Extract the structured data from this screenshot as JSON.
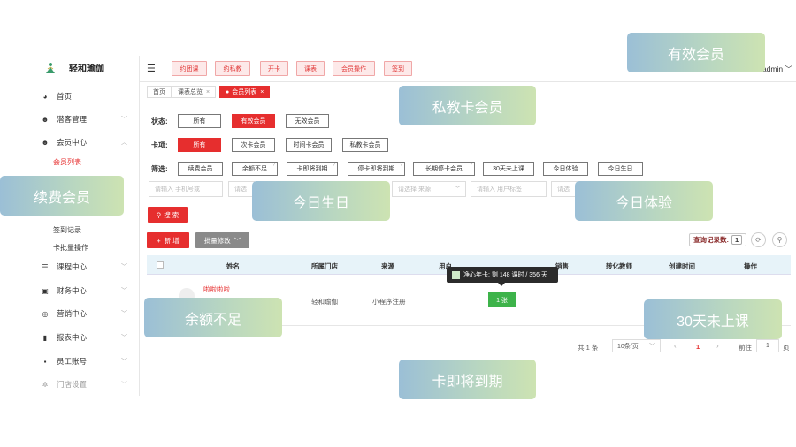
{
  "app": {
    "name": "轻和瑜伽",
    "user": "admin"
  },
  "sidebar": {
    "items": [
      {
        "label": "首页",
        "icon": "dashboard-icon",
        "glyph": "◕"
      },
      {
        "label": "潜客管理",
        "icon": "user-icon",
        "glyph": "☻"
      },
      {
        "label": "会员中心",
        "icon": "user-icon",
        "glyph": "☻"
      },
      {
        "label": "课程中心",
        "icon": "list-icon",
        "glyph": "☰"
      },
      {
        "label": "财务中心",
        "icon": "finance-icon",
        "glyph": "▣"
      },
      {
        "label": "营销中心",
        "icon": "target-icon",
        "glyph": "◎"
      },
      {
        "label": "报表中心",
        "icon": "bar-chart-icon",
        "glyph": "▮"
      },
      {
        "label": "员工账号",
        "icon": "lock-icon",
        "glyph": "▪"
      },
      {
        "label": "门店设置",
        "icon": "settings-icon",
        "glyph": "✲"
      }
    ],
    "subitems": [
      "会员列表",
      "签到记录",
      "卡批量操作"
    ]
  },
  "topbar": {
    "buttons": [
      "约团课",
      "约私教",
      "开卡",
      "课表",
      "会员操作",
      "签到"
    ]
  },
  "breadcrumbs": [
    "首页",
    "课表总览",
    "会员列表"
  ],
  "filters": {
    "status_label": "状态:",
    "status_options": [
      "所有",
      "有效会员",
      "无效会员"
    ],
    "card_label": "卡项:",
    "card_options": [
      "所有",
      "次卡会员",
      "时间卡会员",
      "私教卡会员"
    ],
    "screen_label": "筛选:",
    "screen_options": [
      "续费会员",
      "余额不足",
      "卡即将到期",
      "停卡即将到期",
      "长期停卡会员",
      "30天未上课",
      "今日体验",
      "今日生日"
    ]
  },
  "search": {
    "phone_placeholder": "请输入 手机号或",
    "select_placeholder": "请选",
    "source_placeholder": "请选择 来源",
    "tag_placeholder": "请输入 用户标签",
    "search_button": "搜 索",
    "add_button": "新 增",
    "batch_button": "批量修改",
    "count_label": "查询记录数:",
    "count_value": "1"
  },
  "table": {
    "headers": [
      "姓名",
      "所属门店",
      "来源",
      "用户",
      "销售",
      "转化教师",
      "创建时间",
      "操作"
    ],
    "rows": [
      {
        "name": "啦啦啦啦",
        "store": "轻和瑜伽",
        "source": "小程序注册",
        "cards": "1 张"
      }
    ]
  },
  "tooltip": {
    "text": "净心年卡: 剩 148 课时 / 356 天"
  },
  "pager": {
    "total": "共 1 条",
    "page_size": "10条/页",
    "current": "1",
    "goto_label": "前往",
    "goto_value": "1",
    "page_suffix": "页"
  },
  "overlay_tags": [
    "有效会员",
    "私教卡会员",
    "续费会员",
    "今日生日",
    "今日体验",
    "余额不足",
    "30天未上课",
    "卡即将到期"
  ],
  "colors": {
    "accent": "#e62e2e",
    "table_header": "#e7f3f9",
    "card_badge": "#3db34a"
  }
}
